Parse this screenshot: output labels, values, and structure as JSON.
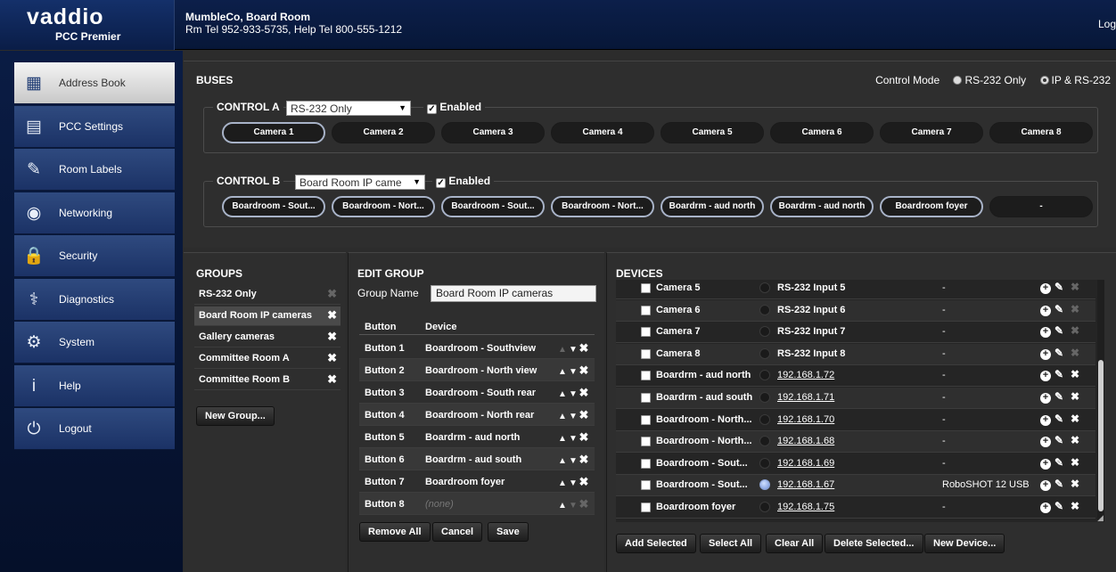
{
  "header": {
    "brand": "vaddio",
    "product": "PCC Premier",
    "room_name": "MumbleCo, Board Room",
    "room_tel": "Rm Tel 952-933-5735, Help Tel 800-555-1212",
    "logout_label": "Log"
  },
  "sidebar": {
    "items": [
      {
        "label": "Address Book",
        "icon": "address-book-icon",
        "glyph": "▦",
        "active": true
      },
      {
        "label": "PCC Settings",
        "icon": "pcc-settings-icon",
        "glyph": "▤",
        "active": false
      },
      {
        "label": "Room Labels",
        "icon": "room-labels-icon",
        "glyph": "✎",
        "active": false
      },
      {
        "label": "Networking",
        "icon": "networking-icon",
        "glyph": "◉",
        "active": false
      },
      {
        "label": "Security",
        "icon": "security-icon",
        "glyph": "🔒",
        "active": false
      },
      {
        "label": "Diagnostics",
        "icon": "diagnostics-icon",
        "glyph": "⚕",
        "active": false
      },
      {
        "label": "System",
        "icon": "system-icon",
        "glyph": "⚙",
        "active": false
      },
      {
        "label": "Help",
        "icon": "help-icon",
        "glyph": "i",
        "active": false
      },
      {
        "label": "Logout",
        "icon": "power-icon",
        "glyph": "⏻",
        "active": false
      }
    ]
  },
  "buses": {
    "title": "BUSES",
    "control_mode_label": "Control Mode",
    "modes": [
      {
        "label": "RS-232 Only",
        "selected": false
      },
      {
        "label": "IP & RS-232",
        "selected": true
      }
    ],
    "control_a": {
      "label": "CONTROL A",
      "group": "RS-232 Only",
      "enabled_label": "Enabled",
      "buttons": [
        "Camera 1",
        "Camera 2",
        "Camera 3",
        "Camera 4",
        "Camera 5",
        "Camera 6",
        "Camera 7",
        "Camera 8"
      ],
      "selected_index": 0
    },
    "control_b": {
      "label": "CONTROL B",
      "group": "Board Room IP came",
      "enabled_label": "Enabled",
      "buttons": [
        "Boardroom - Sout...",
        "Boardroom - Nort...",
        "Boardroom - Sout...",
        "Boardroom - Nort...",
        "Boardrm - aud north",
        "Boardrm - aud north",
        "Boardroom foyer",
        "-"
      ],
      "outlined": [
        true,
        true,
        true,
        true,
        true,
        true,
        true,
        false
      ]
    }
  },
  "groups": {
    "title": "GROUPS",
    "items": [
      {
        "label": "RS-232 Only",
        "deletable": false,
        "selected": false
      },
      {
        "label": "Board Room IP cameras",
        "deletable": true,
        "selected": true
      },
      {
        "label": "Gallery cameras",
        "deletable": true,
        "selected": false
      },
      {
        "label": "Committee Room A",
        "deletable": true,
        "selected": false
      },
      {
        "label": "Committee Room B",
        "deletable": true,
        "selected": false
      }
    ],
    "new_group_label": "New Group..."
  },
  "edit_group": {
    "title": "EDIT GROUP",
    "group_name_label": "Group Name",
    "group_name_value": "Board Room IP cameras",
    "columns": [
      "Button",
      "Device"
    ],
    "rows": [
      {
        "button": "Button 1",
        "device": "Boardroom - Southview",
        "up": false,
        "down": true
      },
      {
        "button": "Button 2",
        "device": "Boardroom - North view",
        "up": true,
        "down": true
      },
      {
        "button": "Button 3",
        "device": "Boardroom - South rear",
        "up": true,
        "down": true
      },
      {
        "button": "Button 4",
        "device": "Boardroom - North rear",
        "up": true,
        "down": true
      },
      {
        "button": "Button 5",
        "device": "Boardrm - aud north",
        "up": true,
        "down": true
      },
      {
        "button": "Button 6",
        "device": "Boardrm - aud south",
        "up": true,
        "down": true
      },
      {
        "button": "Button 7",
        "device": "Boardroom foyer",
        "up": true,
        "down": true
      },
      {
        "button": "Button 8",
        "device": "(none)",
        "up": true,
        "down": false
      }
    ],
    "remove_all_label": "Remove All",
    "cancel_label": "Cancel",
    "save_label": "Save"
  },
  "devices": {
    "title": "DEVICES",
    "rows": [
      {
        "name": "Camera 5",
        "address": "RS-232 Input 5",
        "link": false,
        "model": "-",
        "online": false,
        "deletable": false
      },
      {
        "name": "Camera 6",
        "address": "RS-232 Input 6",
        "link": false,
        "model": "-",
        "online": false,
        "deletable": false
      },
      {
        "name": "Camera 7",
        "address": "RS-232 Input 7",
        "link": false,
        "model": "-",
        "online": false,
        "deletable": false
      },
      {
        "name": "Camera 8",
        "address": "RS-232 Input 8",
        "link": false,
        "model": "-",
        "online": false,
        "deletable": false
      },
      {
        "name": "Boardrm - aud north",
        "address": "192.168.1.72",
        "link": true,
        "model": "-",
        "online": false,
        "deletable": true
      },
      {
        "name": "Boardrm - aud south",
        "address": "192.168.1.71",
        "link": true,
        "model": "-",
        "online": false,
        "deletable": true
      },
      {
        "name": "Boardroom - North...",
        "address": "192.168.1.70",
        "link": true,
        "model": "-",
        "online": false,
        "deletable": true
      },
      {
        "name": "Boardroom - North...",
        "address": "192.168.1.68",
        "link": true,
        "model": "-",
        "online": false,
        "deletable": true
      },
      {
        "name": "Boardroom - Sout...",
        "address": "192.168.1.69",
        "link": true,
        "model": "-",
        "online": false,
        "deletable": true
      },
      {
        "name": "Boardroom - Sout...",
        "address": "192.168.1.67",
        "link": true,
        "model": "RoboSHOT 12 USB",
        "online": true,
        "deletable": true
      },
      {
        "name": "Boardroom foyer",
        "address": "192.168.1.75",
        "link": true,
        "model": "-",
        "online": false,
        "deletable": true
      }
    ],
    "add_selected_label": "Add Selected",
    "select_all_label": "Select All",
    "clear_all_label": "Clear All",
    "delete_selected_label": "Delete Selected...",
    "new_device_label": "New Device..."
  }
}
